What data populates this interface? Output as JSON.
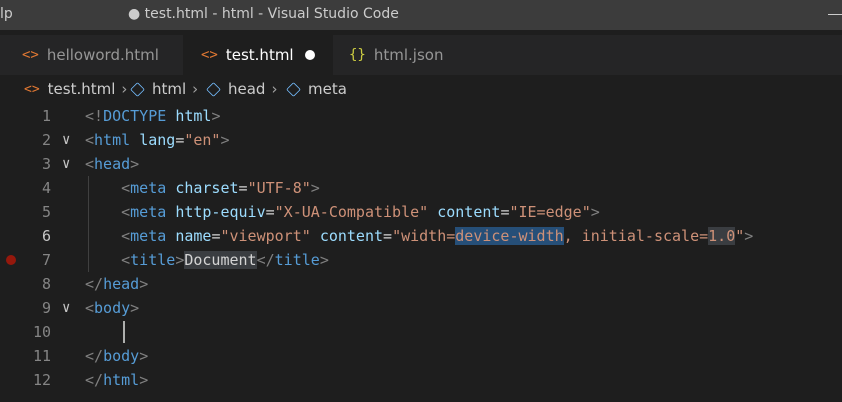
{
  "window": {
    "app_icon_glyph": "lp",
    "title": "● test.html - html - Visual Studio Code"
  },
  "tabs": [
    {
      "label": "helloword.html",
      "icon": "<>",
      "icon_name": "html-file-icon",
      "active": false
    },
    {
      "label": "test.html",
      "icon": "<>",
      "icon_name": "html-file-icon",
      "active": true,
      "dirty": true
    },
    {
      "label": "html.json",
      "icon": "{}",
      "icon_name": "json-file-icon",
      "active": false
    }
  ],
  "breadcrumb": {
    "file": "test.html",
    "file_icon": "<>",
    "items": [
      "html",
      "head",
      "meta"
    ]
  },
  "editor": {
    "current_line": 6,
    "breakpoint_line": 7,
    "cursor_line": 10,
    "lines": [
      {
        "n": "1",
        "fold": "",
        "indent": "",
        "tokens": [
          [
            "p",
            "<!"
          ],
          [
            "tag",
            "DOCTYPE"
          ],
          [
            "t",
            " "
          ],
          [
            "attr",
            "html"
          ],
          [
            "p",
            ">"
          ]
        ]
      },
      {
        "n": "2",
        "fold": "∨",
        "indent": "",
        "tokens": [
          [
            "p",
            "<"
          ],
          [
            "tag",
            "html"
          ],
          [
            "t",
            " "
          ],
          [
            "attr",
            "lang"
          ],
          [
            "t",
            "="
          ],
          [
            "str",
            "\"en\""
          ],
          [
            "p",
            ">"
          ]
        ]
      },
      {
        "n": "3",
        "fold": "∨",
        "indent": "",
        "tokens": [
          [
            "p",
            "<"
          ],
          [
            "tag",
            "head"
          ],
          [
            "p",
            ">"
          ]
        ]
      },
      {
        "n": "4",
        "fold": "",
        "indent": "    ",
        "tokens": [
          [
            "p",
            "<"
          ],
          [
            "tag",
            "meta"
          ],
          [
            "t",
            " "
          ],
          [
            "attr",
            "charset"
          ],
          [
            "t",
            "="
          ],
          [
            "str",
            "\"UTF-8\""
          ],
          [
            "p",
            ">"
          ]
        ]
      },
      {
        "n": "5",
        "fold": "",
        "indent": "    ",
        "tokens": [
          [
            "p",
            "<"
          ],
          [
            "tag",
            "meta"
          ],
          [
            "t",
            " "
          ],
          [
            "attr",
            "http-equiv"
          ],
          [
            "t",
            "="
          ],
          [
            "str",
            "\"X-UA-Compatible\""
          ],
          [
            "t",
            " "
          ],
          [
            "attr",
            "content"
          ],
          [
            "t",
            "="
          ],
          [
            "str",
            "\"IE=edge\""
          ],
          [
            "p",
            ">"
          ]
        ]
      },
      {
        "n": "6",
        "fold": "",
        "indent": "    ",
        "tokens": [
          [
            "p",
            "<"
          ],
          [
            "tag",
            "meta"
          ],
          [
            "t",
            " "
          ],
          [
            "attr",
            "name"
          ],
          [
            "t",
            "="
          ],
          [
            "str",
            "\"viewport\""
          ],
          [
            "t",
            " "
          ],
          [
            "attr",
            "content"
          ],
          [
            "t",
            "="
          ],
          [
            "str",
            "\"width="
          ],
          [
            "strhl",
            "device-width"
          ],
          [
            "str",
            ", initial-scale="
          ],
          [
            "strhl2",
            "1.0"
          ],
          [
            "str",
            "\""
          ],
          [
            "p",
            ">"
          ]
        ]
      },
      {
        "n": "7",
        "fold": "",
        "indent": "    ",
        "tokens": [
          [
            "p",
            "<"
          ],
          [
            "tag",
            "title"
          ],
          [
            "p",
            ">"
          ],
          [
            "texthl",
            "Document"
          ],
          [
            "p",
            "</"
          ],
          [
            "tag",
            "title"
          ],
          [
            "p",
            ">"
          ]
        ]
      },
      {
        "n": "8",
        "fold": "",
        "indent": "",
        "tokens": [
          [
            "p",
            "</"
          ],
          [
            "tag",
            "head"
          ],
          [
            "p",
            ">"
          ]
        ]
      },
      {
        "n": "9",
        "fold": "∨",
        "indent": "",
        "tokens": [
          [
            "p",
            "<"
          ],
          [
            "tag",
            "body"
          ],
          [
            "p",
            ">"
          ]
        ]
      },
      {
        "n": "10",
        "fold": "",
        "indent": "",
        "tokens": []
      },
      {
        "n": "11",
        "fold": "",
        "indent": "",
        "tokens": [
          [
            "p",
            "</"
          ],
          [
            "tag",
            "body"
          ],
          [
            "p",
            ">"
          ]
        ]
      },
      {
        "n": "12",
        "fold": "",
        "indent": "",
        "tokens": [
          [
            "p",
            "</"
          ],
          [
            "tag",
            "html"
          ],
          [
            "p",
            ">"
          ]
        ]
      }
    ]
  },
  "colors": {
    "background": "#1e1e1e",
    "tag": "#569cd6",
    "attribute": "#9cdcfe",
    "string": "#ce9178",
    "selection": "#264f78"
  }
}
